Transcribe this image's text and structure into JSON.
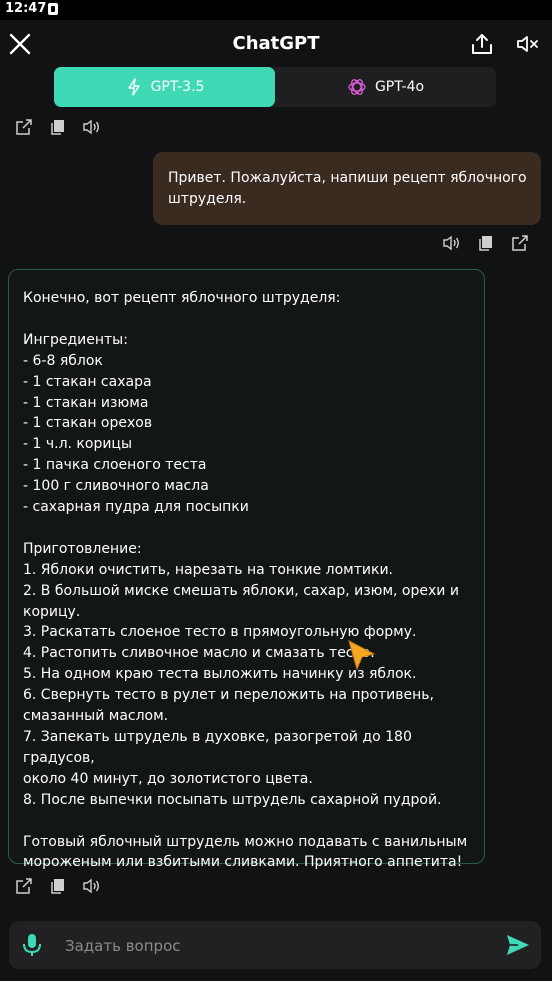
{
  "status_bar": {
    "time": "12:47"
  },
  "header": {
    "title": "ChatGPT"
  },
  "model_tabs": [
    {
      "label": "GPT-3.5",
      "active": true,
      "icon": "openai-outline-icon"
    },
    {
      "label": "GPT-4o",
      "active": false,
      "icon": "openai-pink-icon"
    }
  ],
  "messages": {
    "user": "Привет. Пожалуйста, напиши рецепт яблочного штруделя.",
    "assistant_lines": [
      "Конечно, вот рецепт яблочного штруделя:",
      "",
      "Ингредиенты:",
      "- 6-8 яблок",
      "- 1 стакан сахара",
      "- 1 стакан изюма",
      "- 1 стакан орехов",
      "- 1 ч.л. корицы",
      "- 1 пачка слоеного теста",
      "- 100 г сливочного масла",
      "- сахарная пудра для посыпки",
      "",
      "Приготовление:",
      "1. Яблоки очистить, нарезать на тонкие ломтики.",
      "2. В большой миске смешать яблоки, сахар, изюм, орехи и",
      "корицу.",
      "3. Раскатать слоеное тесто в прямоугольную форму.",
      "4. Растопить сливочное масло и смазать тесто.",
      "5. На одном краю теста выложить начинку из яблок.",
      "6. Свернуть тесто в рулет и переложить на противень,",
      "смазанный маслом.",
      "7. Запекать штрудель в духовке, разогретой до 180 градусов,",
      "около 40 минут, до золотистого цвета.",
      "8. После выпечки посыпать штрудель сахарной пудрой.",
      "",
      "Готовый яблочный штрудель можно подавать с ванильным",
      "мороженым или взбитыми сливками. Приятного аппетита!"
    ]
  },
  "input": {
    "placeholder": "Задать вопрос",
    "value": ""
  },
  "colors": {
    "accent": "#3fd9b6",
    "user_bubble": "#3a2b21",
    "assistant_border": "#2c5a4a",
    "gpt4o_icon": "#e05fd8",
    "send": "#3fd9b6",
    "mic": "#3fd9b6"
  }
}
